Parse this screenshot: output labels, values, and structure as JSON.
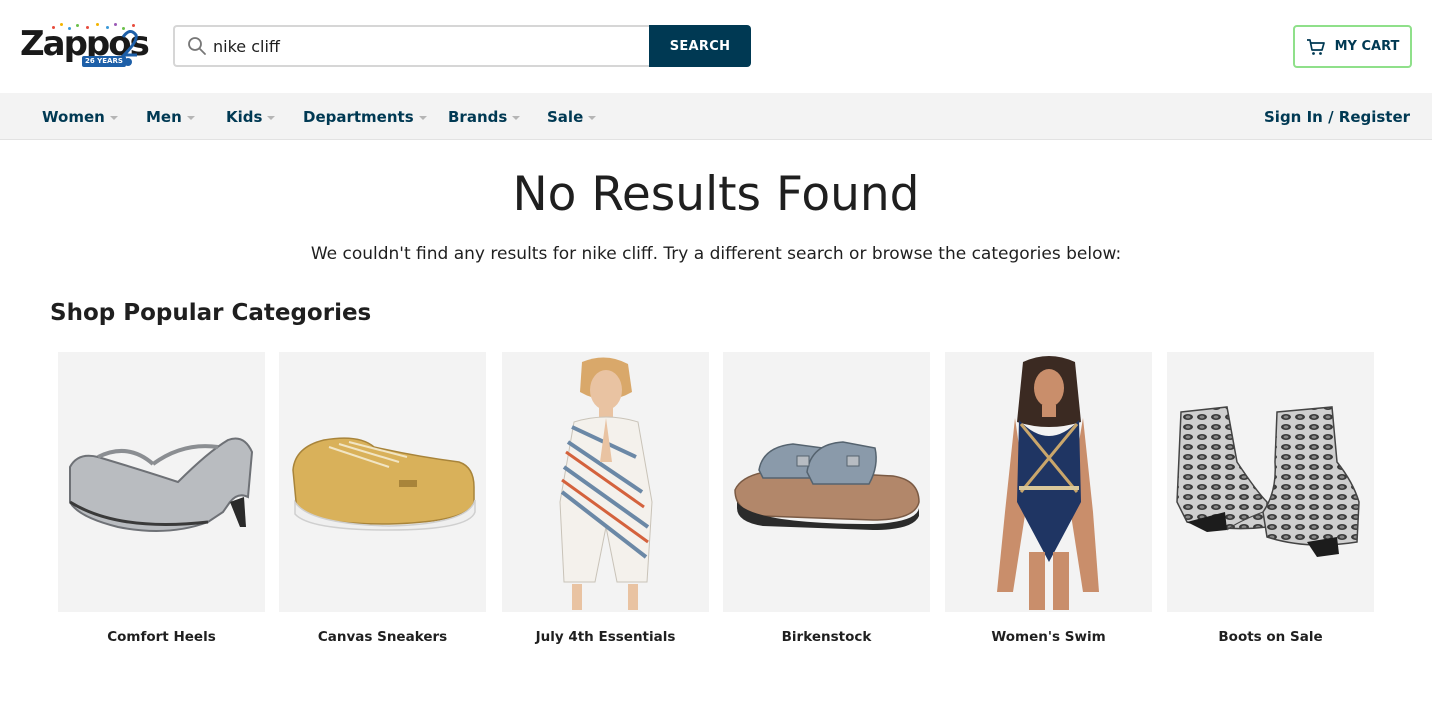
{
  "header": {
    "logo_text": "Zappos",
    "logo_badge": "26 YEARS",
    "search": {
      "value": "nike cliff",
      "button_label": "SEARCH"
    },
    "cart_label": "MY CART"
  },
  "nav": {
    "items": [
      {
        "label": "Women"
      },
      {
        "label": "Men"
      },
      {
        "label": "Kids"
      },
      {
        "label": "Departments"
      },
      {
        "label": "Brands"
      },
      {
        "label": "Sale"
      }
    ],
    "sign_in": "Sign In / Register"
  },
  "main": {
    "title": "No Results Found",
    "subtitle": "We couldn't find any results for nike cliff. Try a different search or browse the categories below:",
    "section_title": "Shop Popular Categories",
    "categories": [
      {
        "label": "Comfort Heels",
        "icon": "silver-heel-image"
      },
      {
        "label": "Canvas Sneakers",
        "icon": "yellow-sneaker-image"
      },
      {
        "label": "July 4th Essentials",
        "icon": "striped-romper-image"
      },
      {
        "label": "Birkenstock",
        "icon": "sandal-image"
      },
      {
        "label": "Women's Swim",
        "icon": "swimsuit-image"
      },
      {
        "label": "Boots on Sale",
        "icon": "snakeskin-boot-image"
      }
    ]
  },
  "colors": {
    "brand_navy": "#003953",
    "cart_border": "#8fe08a",
    "nav_bg": "#f3f3f3",
    "logo_blue": "#1d5fa8"
  }
}
